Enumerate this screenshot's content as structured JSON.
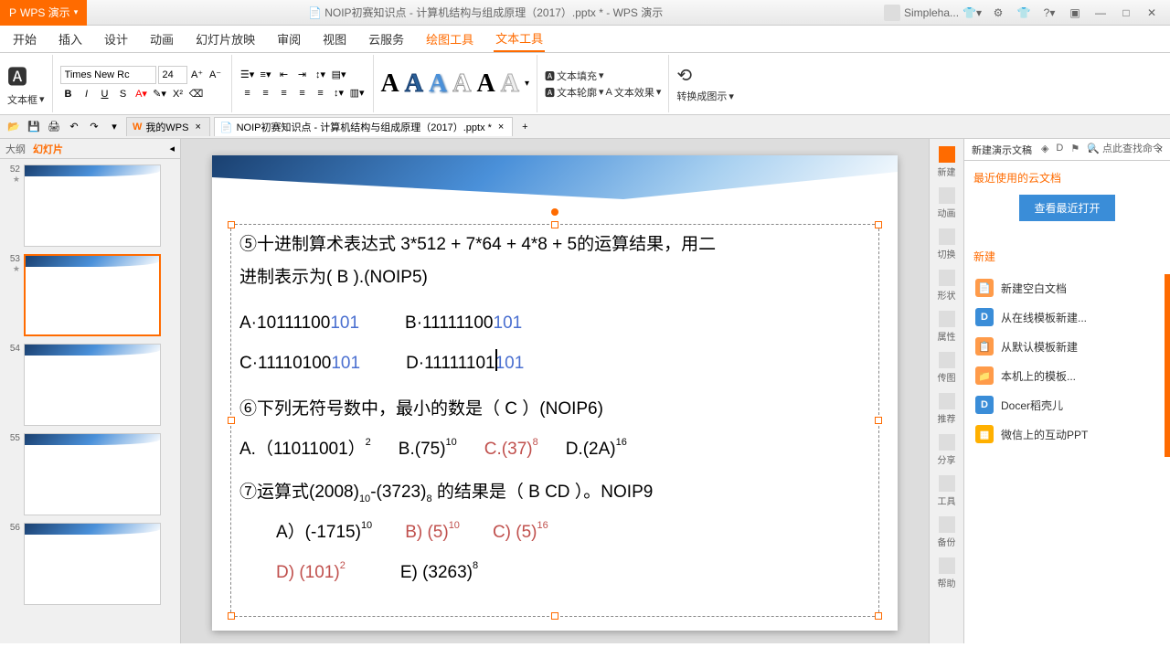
{
  "title": "NOIP初赛知识点 - 计算机结构与组成原理（2017）.pptx * - WPS 演示",
  "app_name": "WPS 演示",
  "user": "Simpleha...",
  "menu": {
    "begin": "开始",
    "insert": "插入",
    "design": "设计",
    "animation": "动画",
    "slideshow": "幻灯片放映",
    "review": "审阅",
    "view": "视图",
    "cloud": "云服务",
    "draw": "绘图工具",
    "text": "文本工具"
  },
  "ribbon": {
    "textbox": "文本框",
    "font_name": "Times New Rc",
    "font_size": "24",
    "text_fill": "文本填充",
    "text_outline": "文本轮廓",
    "text_effect": "文本效果",
    "convert": "转换成图示"
  },
  "tabs": {
    "mywps": "我的WPS",
    "doc": "NOIP初赛知识点 - 计算机结构与组成原理（2017）.pptx *"
  },
  "outline": {
    "tab1": "大纲",
    "tab2": "幻灯片"
  },
  "thumbs": [
    52,
    53,
    54,
    55,
    56
  ],
  "slide": {
    "q5_text1": "⑤十进制算术表达式 3*512 + 7*64 + 4*8 + 5的运算结果，用二",
    "q5_text2": "进制表示为(    B    ).(NOIP5)",
    "q5_a": "A·10111100",
    "q5_a2": "101",
    "q5_b": "B·11111100",
    "q5_b2": "101",
    "q5_c": "C·11110100",
    "q5_c2": "101",
    "q5_d": "D·11111101",
    "q5_d2": "101",
    "q6_text": "⑥下列无符号数中，最小的数是（  C   ）(NOIP6)",
    "q6_a": "A.（11011001）",
    "q6_a_sub": "2",
    "q6_b": "B.(75)",
    "q6_b_sub": "10",
    "q6_c": "C.(37)",
    "q6_c_sub": "8",
    "q6_d": "D.(2A)",
    "q6_d_sub": "16",
    "q7_text1": "⑦运算式(2008)",
    "q7_sub1": "10",
    "q7_text2": "-(3723)",
    "q7_sub2": "8",
    "q7_text3": " 的结果是（ B CD ）。NOIP9",
    "q7_a": "A）(-1715)",
    "q7_a_sub": "10",
    "q7_b": "B) (5)",
    "q7_b_sub": "10",
    "q7_c": "C) (5)",
    "q7_c_sub": "16",
    "q7_d": "D)  (101)",
    "q7_d_sub": "2",
    "q7_e": "E) (3263)",
    "q7_e_sub": "8"
  },
  "rightbar": {
    "new": "新建",
    "anim": "动画",
    "trans": "切换",
    "shape": "形状",
    "prop": "属性",
    "media": "传图",
    "recommend": "推荐",
    "share": "分享",
    "tools": "工具",
    "backup": "备份",
    "help": "帮助"
  },
  "newpanel": {
    "title": "新建演示文稿",
    "recent": "最近使用的云文档",
    "view_recent": "查看最近打开",
    "section_new": "新建",
    "blank": "新建空白文档",
    "online": "从在线模板新建...",
    "default": "从默认模板新建",
    "local": "本机上的模板...",
    "docer": "Docer稻壳儿",
    "wechat": "微信上的互动PPT"
  },
  "findbar": {
    "find": "点此查找命令"
  }
}
